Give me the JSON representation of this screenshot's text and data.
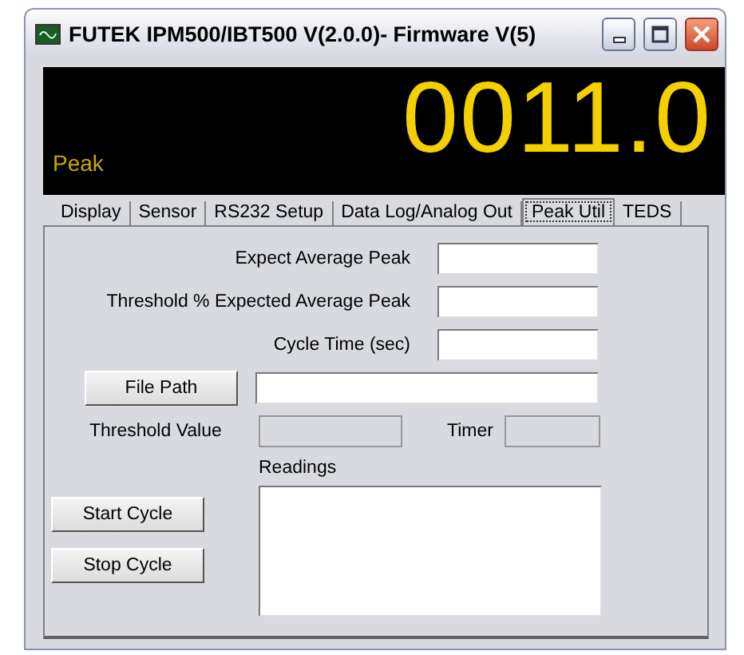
{
  "window": {
    "title": "FUTEK IPM500/IBT500 V(2.0.0)- Firmware V(5)"
  },
  "display": {
    "value": "0011.0",
    "mode": "Peak"
  },
  "tabs": [
    {
      "label": "Display",
      "selected": false
    },
    {
      "label": "Sensor",
      "selected": false
    },
    {
      "label": "RS232 Setup",
      "selected": false
    },
    {
      "label": "Data Log/Analog Out",
      "selected": false
    },
    {
      "label": "Peak Util",
      "selected": true
    },
    {
      "label": "TEDS",
      "selected": false
    }
  ],
  "settings": [
    {
      "label": "Expect Average Peak"
    },
    {
      "label": "Threshold % Expected Average Peak"
    },
    {
      "label": "Cycle Time (sec)"
    }
  ],
  "file_path": {
    "button": "File Path"
  },
  "threshold_value": {
    "label": "Threshold  Value",
    "disabled": true
  },
  "timer": {
    "label": "Timer",
    "disabled": true
  },
  "readings": {
    "label": "Readings"
  },
  "cycle_buttons": [
    "Start Cycle",
    "Stop Cycle"
  ]
}
